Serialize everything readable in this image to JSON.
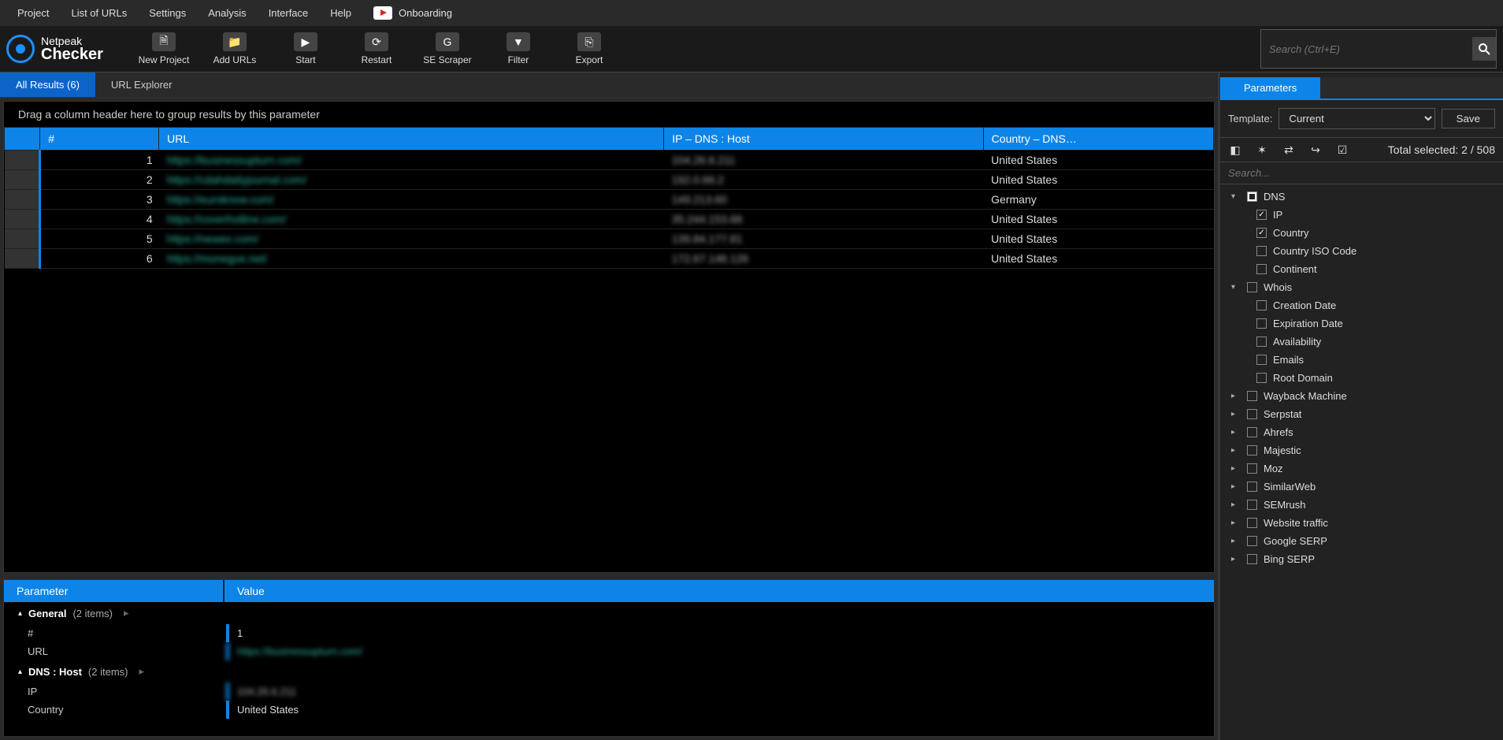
{
  "menu": [
    "Project",
    "List of URLs",
    "Settings",
    "Analysis",
    "Interface",
    "Help"
  ],
  "onboarding_label": "Onboarding",
  "logo": {
    "top": "Netpeak",
    "bottom": "Checker"
  },
  "toolbar": [
    {
      "id": "new-project",
      "label": "New Project"
    },
    {
      "id": "add-urls",
      "label": "Add URLs"
    },
    {
      "id": "start",
      "label": "Start"
    },
    {
      "id": "restart",
      "label": "Restart"
    },
    {
      "id": "se-scraper",
      "label": "SE Scraper"
    },
    {
      "id": "filter",
      "label": "Filter"
    },
    {
      "id": "export",
      "label": "Export"
    }
  ],
  "search_placeholder": "Search (Ctrl+E)",
  "tabs": {
    "all_results": "All Results (6)",
    "url_explorer": "URL Explorer"
  },
  "group_hint": "Drag a column header here to group results by this parameter",
  "columns": {
    "num": "#",
    "url": "URL",
    "ip": "IP  –  DNS  :  Host",
    "country": "Country  –  DNS…"
  },
  "rows": [
    {
      "n": 1,
      "url": "https://businessupturn.com/",
      "ip": "104.26.6.211",
      "country": "United States"
    },
    {
      "n": 2,
      "url": "https://cdahdailyjournal.com/",
      "ip": "192.0.66.2",
      "country": "United States"
    },
    {
      "n": 3,
      "url": "https://euroknow.com/",
      "ip": "149.213.60",
      "country": "Germany"
    },
    {
      "n": 4,
      "url": "https://coverhotline.com/",
      "ip": "35.244.153.68",
      "country": "United States"
    },
    {
      "n": 5,
      "url": "https://newex.com/",
      "ip": "139.84.177.81",
      "country": "United States"
    },
    {
      "n": 6,
      "url": "https://monegue.net/",
      "ip": "172.67.146.126",
      "country": "United States"
    }
  ],
  "bottom": {
    "col_param": "Parameter",
    "col_value": "Value",
    "groups": [
      {
        "name": "General",
        "count": "(2 items)",
        "rows": [
          {
            "k": "#",
            "v": "1"
          },
          {
            "k": "URL",
            "v": "https://businessupturn.com/",
            "blur": "url"
          }
        ]
      },
      {
        "name": "DNS  :  Host",
        "count": "(2 items)",
        "rows": [
          {
            "k": "IP",
            "v": "104.26.6.211",
            "blur": "ip"
          },
          {
            "k": "Country",
            "v": "United States"
          }
        ]
      }
    ]
  },
  "side": {
    "tab": "Parameters",
    "template_label": "Template:",
    "template_value": "Current",
    "save": "Save",
    "total_selected": "Total selected: 2 / 508",
    "search_placeholder": "Search...",
    "tree": [
      {
        "type": "group",
        "expanded": true,
        "label": "DNS",
        "state": "mixed",
        "children": [
          {
            "label": "IP",
            "checked": true
          },
          {
            "label": "Country",
            "checked": true
          },
          {
            "label": "Country ISO Code",
            "checked": false
          },
          {
            "label": "Continent",
            "checked": false
          }
        ]
      },
      {
        "type": "group",
        "expanded": true,
        "label": "Whois",
        "state": "off",
        "children": [
          {
            "label": "Creation Date",
            "checked": false
          },
          {
            "label": "Expiration Date",
            "checked": false
          },
          {
            "label": "Availability",
            "checked": false
          },
          {
            "label": "Emails",
            "checked": false
          },
          {
            "label": "Root Domain",
            "checked": false
          }
        ]
      },
      {
        "type": "group",
        "expanded": false,
        "label": "Wayback Machine",
        "state": "off"
      },
      {
        "type": "group",
        "expanded": false,
        "label": "Serpstat",
        "state": "off"
      },
      {
        "type": "group",
        "expanded": false,
        "label": "Ahrefs",
        "state": "off"
      },
      {
        "type": "group",
        "expanded": false,
        "label": "Majestic",
        "state": "off"
      },
      {
        "type": "group",
        "expanded": false,
        "label": "Moz",
        "state": "off"
      },
      {
        "type": "group",
        "expanded": false,
        "label": "SimilarWeb",
        "state": "off"
      },
      {
        "type": "group",
        "expanded": false,
        "label": "SEMrush",
        "state": "off"
      },
      {
        "type": "group",
        "expanded": false,
        "label": "Website traffic",
        "state": "off"
      },
      {
        "type": "group",
        "expanded": false,
        "label": "Google SERP",
        "state": "off"
      },
      {
        "type": "group",
        "expanded": false,
        "label": "Bing SERP",
        "state": "off"
      }
    ]
  }
}
